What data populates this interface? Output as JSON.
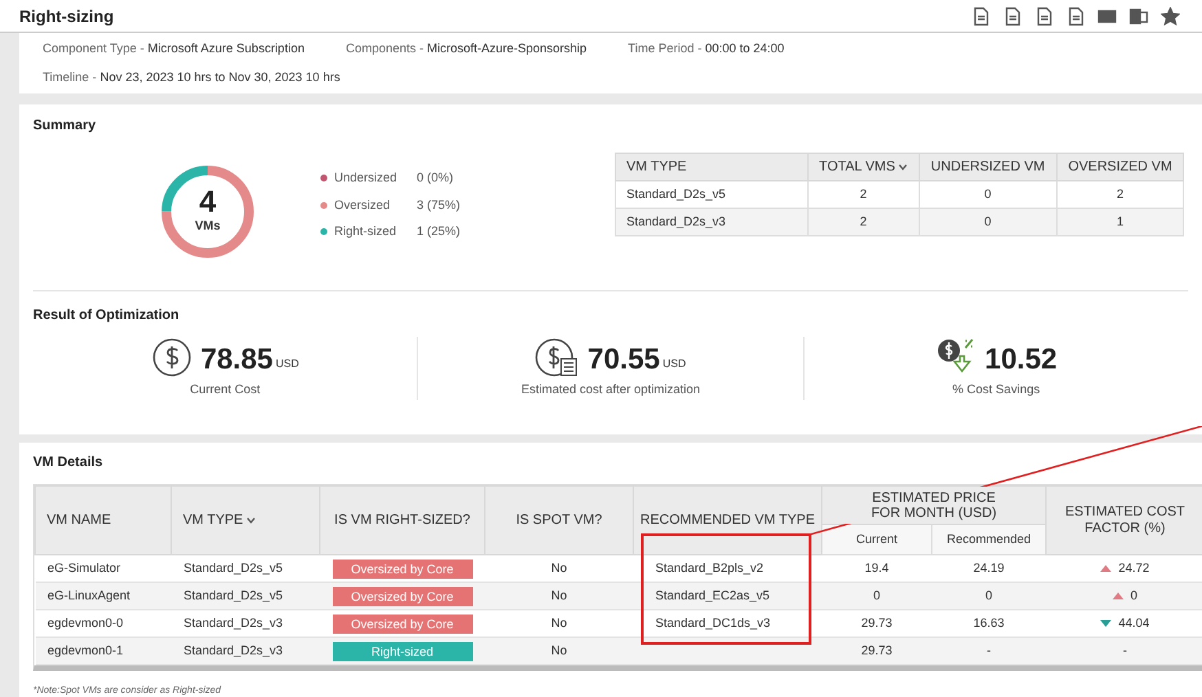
{
  "window": {
    "title": "Right-sizing"
  },
  "filters": [
    {
      "label": "Component Type -",
      "value": "Microsoft Azure Subscription"
    },
    {
      "label": "Components -",
      "value": "Microsoft-Azure-Sponsorship"
    },
    {
      "label": "Time Period -",
      "value": "00:00 to 24:00"
    }
  ],
  "timeline": {
    "label": "Timeline -",
    "value": "Nov 23, 2023 10 hrs to Nov 30, 2023 10 hrs"
  },
  "summary": {
    "title": "Summary",
    "total": "4",
    "total_label": "VMs",
    "legend": [
      {
        "label": "Undersized",
        "value": "0 (0%)",
        "color": "#c2566e",
        "level": 0
      },
      {
        "label": "Oversized",
        "value": "3 (75%)",
        "color": "#e58a8a",
        "level": 0.75
      },
      {
        "label": "Right-sized",
        "value": "1 (25%)",
        "color": "#2bb5a8",
        "level": 0.25
      }
    ],
    "table": {
      "columns": [
        "VM TYPE",
        "TOTAL VMS",
        "UNDERSIZED VM",
        "OVERSIZED VM"
      ],
      "rows": [
        [
          "Standard_D2s_v5",
          "2",
          "0",
          "2"
        ],
        [
          "Standard_D2s_v3",
          "2",
          "0",
          "1"
        ]
      ]
    }
  },
  "optimization": {
    "title": "Result of Optimization",
    "metrics": [
      {
        "kind": "dollar",
        "value": "78.85",
        "unit": "USD",
        "label": "Current Cost"
      },
      {
        "kind": "calculator",
        "value": "70.55",
        "unit": "USD",
        "label": "Estimated cost after optimization"
      },
      {
        "kind": "savings",
        "value": "10.52",
        "label": "% Cost Savings"
      }
    ]
  },
  "vm_details": {
    "title": "VM Details",
    "columns": [
      "VM NAME",
      "VM TYPE",
      "IS VM RIGHT-SIZED?",
      "IS SPOT VM?",
      "RECOMMENDED VM TYPE",
      "ESTIMATED PRICE FOR MONTH (USD)",
      "ESTIMATED COST FACTOR (%)"
    ],
    "subcolumns": [
      "Current",
      "Recommended"
    ],
    "rows": [
      {
        "name": "eG-Simulator",
        "type": "Standard_D2s_v5",
        "status": "Oversized by Core",
        "kind": "oversized",
        "spot": "No",
        "recommended": "Standard_B2pls_v2",
        "current": "19.4",
        "rec_price": "24.19",
        "factor": {
          "kind": "up",
          "value": "24.72"
        }
      },
      {
        "name": "eG-LinuxAgent",
        "type": "Standard_D2s_v5",
        "status": "Oversized by Core",
        "kind": "oversized",
        "spot": "No",
        "recommended": "Standard_EC2as_v5",
        "current": "0",
        "rec_price": "0",
        "factor": {
          "kind": "up",
          "value": "0"
        }
      },
      {
        "name": "egdevmon0-0",
        "type": "Standard_D2s_v3",
        "status": "Oversized by Core",
        "kind": "oversized",
        "spot": "No",
        "recommended": "Standard_DC1ds_v3",
        "current": "29.73",
        "rec_price": "16.63",
        "factor": {
          "kind": "down",
          "value": "44.04"
        }
      },
      {
        "name": "egdevmon0-1",
        "type": "Standard_D2s_v3",
        "status": "Right-sized",
        "kind": "right-sized",
        "spot": "No",
        "current": "29.73",
        "rec_price": "-",
        "factor": {
          "kind": "none",
          "value": "-"
        }
      }
    ],
    "note": "*Note:Spot VMs are consider as Right-sized"
  }
}
